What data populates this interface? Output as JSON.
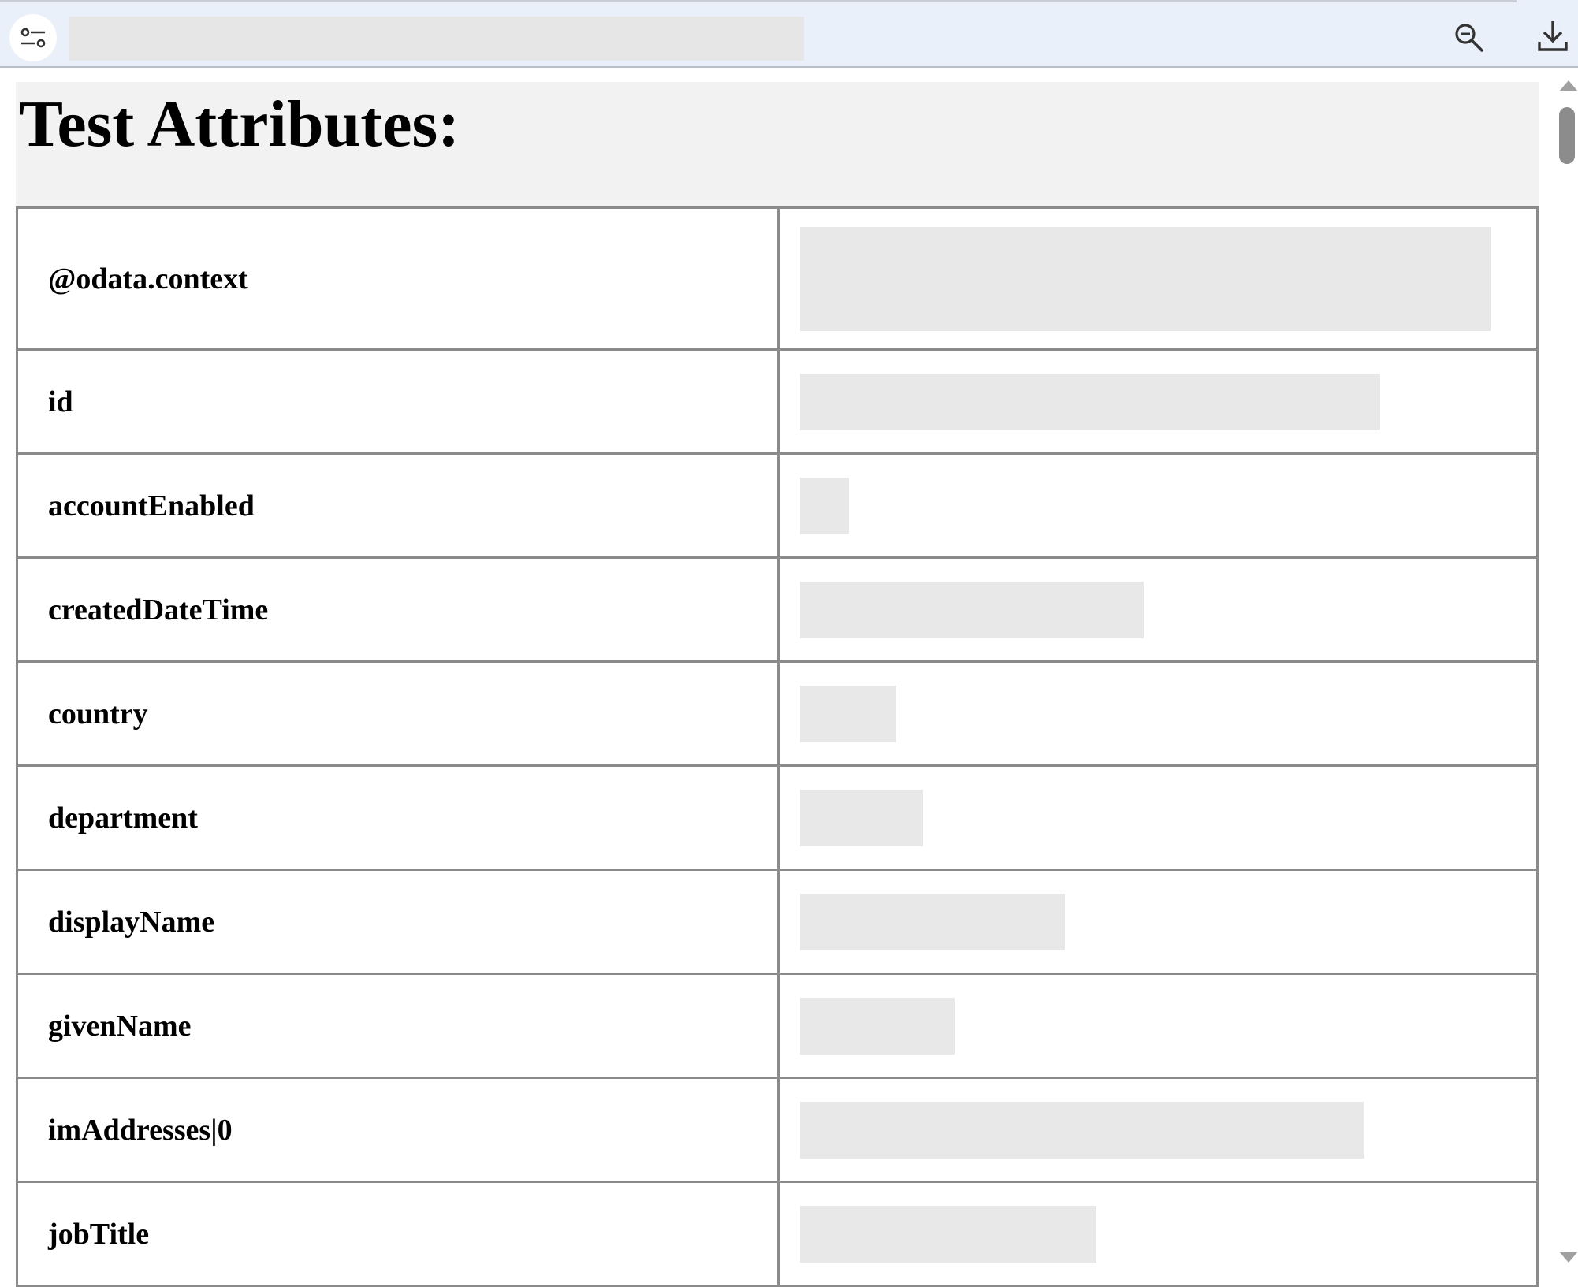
{
  "toolbar": {
    "url_value": "",
    "tune_icon": "tune-sliders-icon",
    "zoom_icon": "zoom-out-icon",
    "download_icon": "download-icon"
  },
  "page": {
    "title": "Test Attributes:"
  },
  "attributes": [
    {
      "key": "@odata.context",
      "value": ""
    },
    {
      "key": "id",
      "value": ""
    },
    {
      "key": "accountEnabled",
      "value": ""
    },
    {
      "key": "createdDateTime",
      "value": ""
    },
    {
      "key": "country",
      "value": ""
    },
    {
      "key": "department",
      "value": ""
    },
    {
      "key": "displayName",
      "value": ""
    },
    {
      "key": "givenName",
      "value": ""
    },
    {
      "key": "imAddresses|0",
      "value": ""
    },
    {
      "key": "jobTitle",
      "value": ""
    }
  ],
  "colors": {
    "toolbar_bg": "#e9f0f9",
    "title_band_bg": "#f2f2f2",
    "redaction": "#e8e8e8",
    "table_border": "#8a8a8a"
  }
}
